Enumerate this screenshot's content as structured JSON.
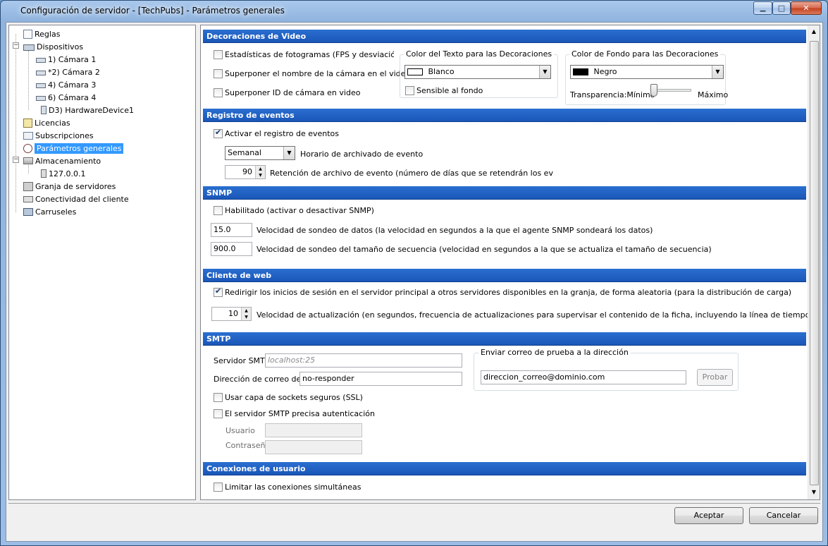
{
  "window": {
    "title": "Configuración de servidor - [TechPubs] - Parámetros generales",
    "min_glyph": "▁",
    "max_glyph": "□",
    "close_glyph": "✕"
  },
  "tree": {
    "items": [
      {
        "label": "Reglas",
        "icon": "rules-icon"
      },
      {
        "label": "Dispositivos",
        "icon": "devices-icon"
      },
      {
        "label": "1) Cámara 1",
        "icon": "camera-icon"
      },
      {
        "label": "*2) Cámara 2",
        "icon": "camera-icon"
      },
      {
        "label": "4) Cámara 3",
        "icon": "camera-icon"
      },
      {
        "label": "6) Cámara 4",
        "icon": "camera-icon"
      },
      {
        "label": "D3) HardwareDevice1",
        "icon": "hardware-device-icon"
      },
      {
        "label": "Licencias",
        "icon": "license-icon"
      },
      {
        "label": "Subscripciones",
        "icon": "subscriptions-icon"
      },
      {
        "label": "Parámetros generales",
        "icon": "general-settings-icon"
      },
      {
        "label": "Almacenamiento",
        "icon": "storage-icon"
      },
      {
        "label": "127.0.0.1",
        "icon": "storage-server-icon"
      },
      {
        "label": "Granja de servidores",
        "icon": "server-farm-icon"
      },
      {
        "label": "Conectividad del cliente",
        "icon": "client-connectivity-icon"
      },
      {
        "label": "Carruseles",
        "icon": "carousels-icon"
      }
    ],
    "selected": "Parámetros generales"
  },
  "video": {
    "header": "Decoraciones de Video",
    "stats_label": "Estadísticas de fotogramas (FPS y desviación de",
    "stats_checked": false,
    "camera_name_label": "Superponer el nombre de la cámara en el video",
    "camera_name_checked": false,
    "camera_id_label": "Superponer ID de cámara en video",
    "camera_id_checked": false,
    "text_color": {
      "title": "Color del Texto para las Decoraciones",
      "value": "Blanco",
      "swatch": "#ffffff",
      "sensitive_label": "Sensible al fondo",
      "sensitive_checked": false
    },
    "bg_color": {
      "title": "Color de Fondo para las Decoraciones",
      "value": "Negro",
      "swatch": "#000000",
      "transparency_label": "Transparencia:",
      "min_label": "Mínimo",
      "max_label": "Máximo"
    }
  },
  "events": {
    "header": "Registro de eventos",
    "enable_label": "Activar el registro de eventos",
    "enable_checked": true,
    "schedule_value": "Semanal",
    "schedule_label": "Horario de archivado de evento",
    "retention_value": "90",
    "retention_label": "Retención de archivo de evento (número de días que se retendrán los eventos ar"
  },
  "snmp": {
    "header": "SNMP",
    "enabled_label": "Habilitado (activar o desactivar SNMP)",
    "enabled_checked": false,
    "poll_value": "15.0",
    "poll_label": "Velocidad de sondeo de datos (la velocidad en segundos a la que el agente SNMP sondeará los datos)",
    "seq_value": "900.0",
    "seq_label": "Velocidad de sondeo del tamaño de secuencia (velocidad en segundos a la que se actualiza el tamaño de secuencia)"
  },
  "web": {
    "header": "Cliente de web",
    "redirect_label": "Redirigir los inicios de sesión en el servidor principal a otros servidores disponibles en la granja, de forma aleatoria (para la distribución de carga)",
    "redirect_checked": true,
    "refresh_value": "10",
    "refresh_label": "Velocidad de actualización (en segundos, frecuencia de actualizaciones para supervisar el contenido de la ficha, incluyendo la línea de tiempo y las alarmas)"
  },
  "smtp": {
    "header": "SMTP",
    "server_label": "Servidor SMTP",
    "server_placeholder": "localhost:25",
    "from_label": "Dirección de correo del re",
    "from_value": "no-responder",
    "ssl_label": "Usar capa de sockets seguros (SSL)",
    "ssl_checked": false,
    "auth_label": "El servidor SMTP precisa autenticación",
    "auth_checked": false,
    "user_label": "Usuario",
    "user_value": "",
    "password_label": "Contraseña",
    "password_value": "",
    "test": {
      "title": "Enviar correo de prueba a la dirección",
      "address": "direccion_correo@dominio.com",
      "button": "Probar"
    }
  },
  "connections": {
    "header": "Conexiones de usuario",
    "limit_label": "Limitar las conexiones simultáneas",
    "limit_checked": false
  },
  "footer": {
    "accept": "Aceptar",
    "cancel": "Cancelar"
  },
  "scroll_up_glyph": "▲",
  "scroll_down_glyph": "▼",
  "combo_arrow_glyph": "▼",
  "spin_up_glyph": "▲",
  "spin_down_glyph": "▼"
}
